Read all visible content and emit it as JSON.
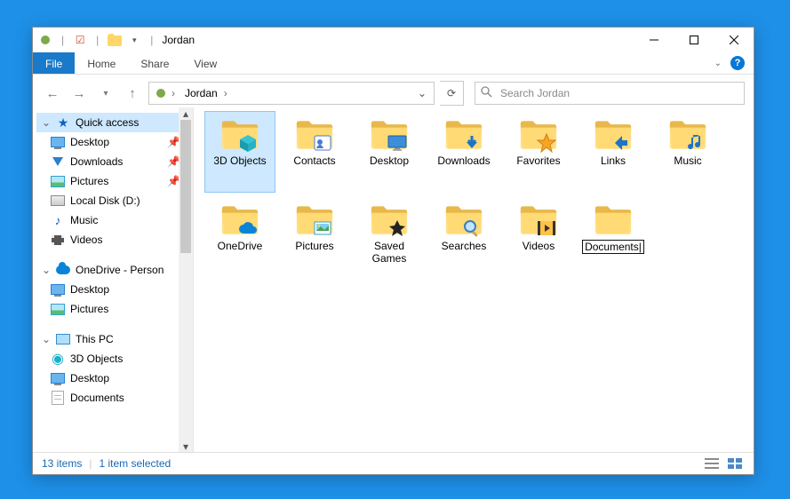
{
  "window": {
    "title": "Jordan"
  },
  "ribbon": {
    "file": "File",
    "tabs": [
      "Home",
      "Share",
      "View"
    ]
  },
  "address": {
    "crumbs": [
      "Jordan"
    ]
  },
  "search": {
    "placeholder": "Search Jordan"
  },
  "nav": {
    "quick_access": {
      "label": "Quick access",
      "items": [
        {
          "label": "Desktop",
          "icon": "monitor",
          "pinned": true
        },
        {
          "label": "Downloads",
          "icon": "down",
          "pinned": true
        },
        {
          "label": "Pictures",
          "icon": "pic",
          "pinned": true
        },
        {
          "label": "Local Disk (D:)",
          "icon": "disk",
          "pinned": false
        },
        {
          "label": "Music",
          "icon": "music",
          "pinned": false
        },
        {
          "label": "Videos",
          "icon": "video",
          "pinned": false
        }
      ]
    },
    "onedrive": {
      "label": "OneDrive - Person",
      "items": [
        {
          "label": "Desktop",
          "icon": "monitor"
        },
        {
          "label": "Pictures",
          "icon": "pic"
        }
      ]
    },
    "this_pc": {
      "label": "This PC",
      "items": [
        {
          "label": "3D Objects",
          "icon": "3d"
        },
        {
          "label": "Desktop",
          "icon": "monitor"
        },
        {
          "label": "Documents",
          "icon": "doc"
        }
      ]
    }
  },
  "items": [
    {
      "label": "3D Objects",
      "overlay": "cube",
      "selected": true
    },
    {
      "label": "Contacts",
      "overlay": "contact"
    },
    {
      "label": "Desktop",
      "overlay": "desktop"
    },
    {
      "label": "Downloads",
      "overlay": "download"
    },
    {
      "label": "Favorites",
      "overlay": "star"
    },
    {
      "label": "Links",
      "overlay": "link"
    },
    {
      "label": "Music",
      "overlay": "music"
    },
    {
      "label": "OneDrive",
      "overlay": "cloud"
    },
    {
      "label": "Pictures",
      "overlay": "pictures"
    },
    {
      "label": "Saved Games",
      "overlay": "games"
    },
    {
      "label": "Searches",
      "overlay": "search"
    },
    {
      "label": "Videos",
      "overlay": "videos"
    },
    {
      "label": "Documents",
      "overlay": "none",
      "renaming": true
    }
  ],
  "status": {
    "count": "13 items",
    "selection": "1 item selected"
  }
}
